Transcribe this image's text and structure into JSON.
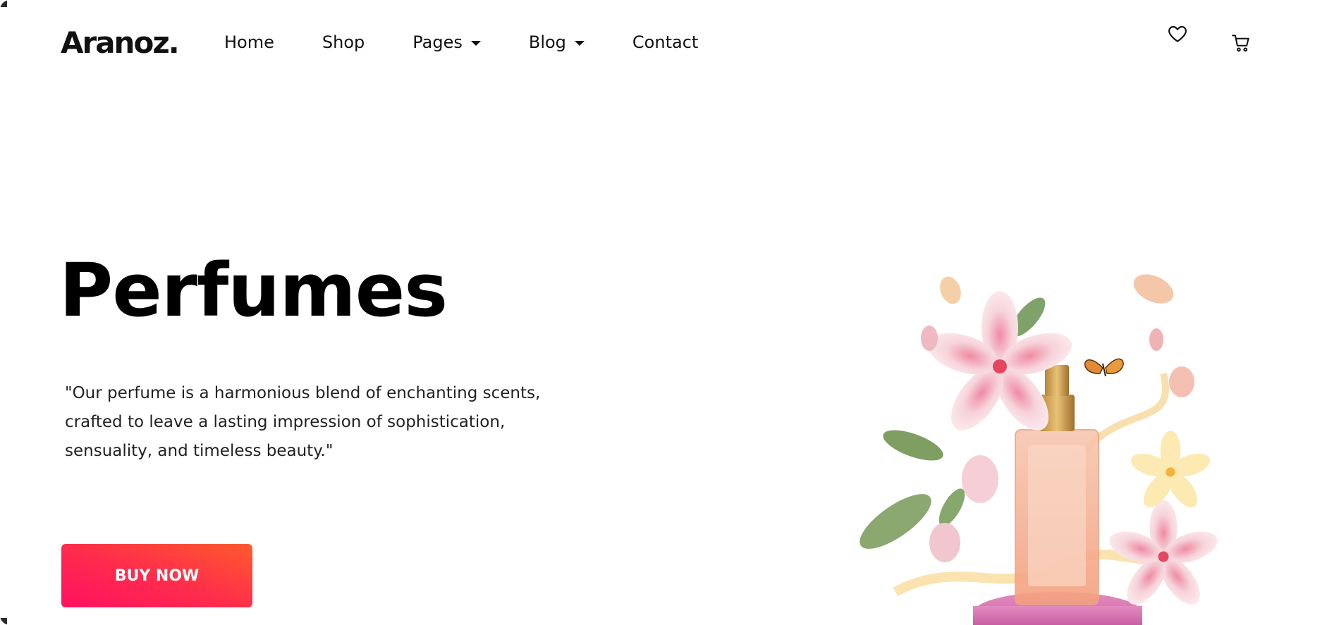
{
  "brand": {
    "name": "Aranoz."
  },
  "nav": {
    "items": [
      {
        "label": "Home",
        "has_dropdown": false
      },
      {
        "label": "Shop",
        "has_dropdown": false
      },
      {
        "label": "Pages",
        "has_dropdown": true
      },
      {
        "label": "Blog",
        "has_dropdown": true
      },
      {
        "label": "Contact",
        "has_dropdown": false
      }
    ],
    "icons": [
      "heart-icon",
      "cart-icon"
    ]
  },
  "hero": {
    "title": "Perfumes",
    "description": "\"Our perfume is a harmonious blend of enchanting scents, crafted to leave a lasting impression of sophistication, sensuality, and timeless beauty.\"",
    "cta_label": "BUY NOW"
  },
  "colors": {
    "cta_gradient_start": "#ff5a2c",
    "cta_gradient_end": "#ff1060",
    "text": "#111111",
    "background": "#ffffff"
  }
}
